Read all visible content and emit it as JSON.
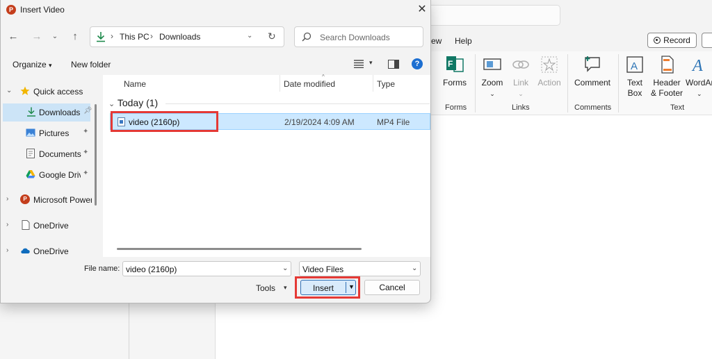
{
  "background_app": {
    "tabs": {
      "partial": "ew",
      "help": "Help"
    },
    "record_label": "Record",
    "ribbon": {
      "forms": "Forms",
      "zoom": "Zoom",
      "link": "Link",
      "action": "Action",
      "comment": "Comment",
      "text_box_line1": "Text",
      "text_box_line2": "Box",
      "header_footer_line1": "Header",
      "header_footer_line2": "& Footer",
      "wordart": "WordArt",
      "groups": {
        "forms": "Forms",
        "links": "Links",
        "comments": "Comments",
        "text": "Text"
      }
    }
  },
  "dialog": {
    "title": "Insert Video",
    "breadcrumbs": [
      "This PC",
      "Downloads"
    ],
    "search_placeholder": "Search Downloads",
    "toolbar": {
      "organize": "Organize",
      "new_folder": "New folder"
    },
    "nav_pane": {
      "quick_access": "Quick access",
      "items": [
        "Downloads",
        "Pictures",
        "Documents",
        "Google Drive"
      ],
      "roots": [
        "Microsoft PowerPoint",
        "OneDrive",
        "OneDrive"
      ]
    },
    "columns": {
      "name": "Name",
      "date": "Date modified",
      "type": "Type"
    },
    "group_header": "Today (1)",
    "files": [
      {
        "name": "video (2160p)",
        "date": "2/19/2024 4:09 AM",
        "type": "MP4 File"
      }
    ],
    "file_name_label": "File name:",
    "file_name_value": "video (2160p)",
    "file_type_value": "Video Files",
    "tools_label": "Tools",
    "insert_label": "Insert",
    "cancel_label": "Cancel",
    "highlight_color": "#e53935",
    "accent_color": "#0067c0"
  }
}
